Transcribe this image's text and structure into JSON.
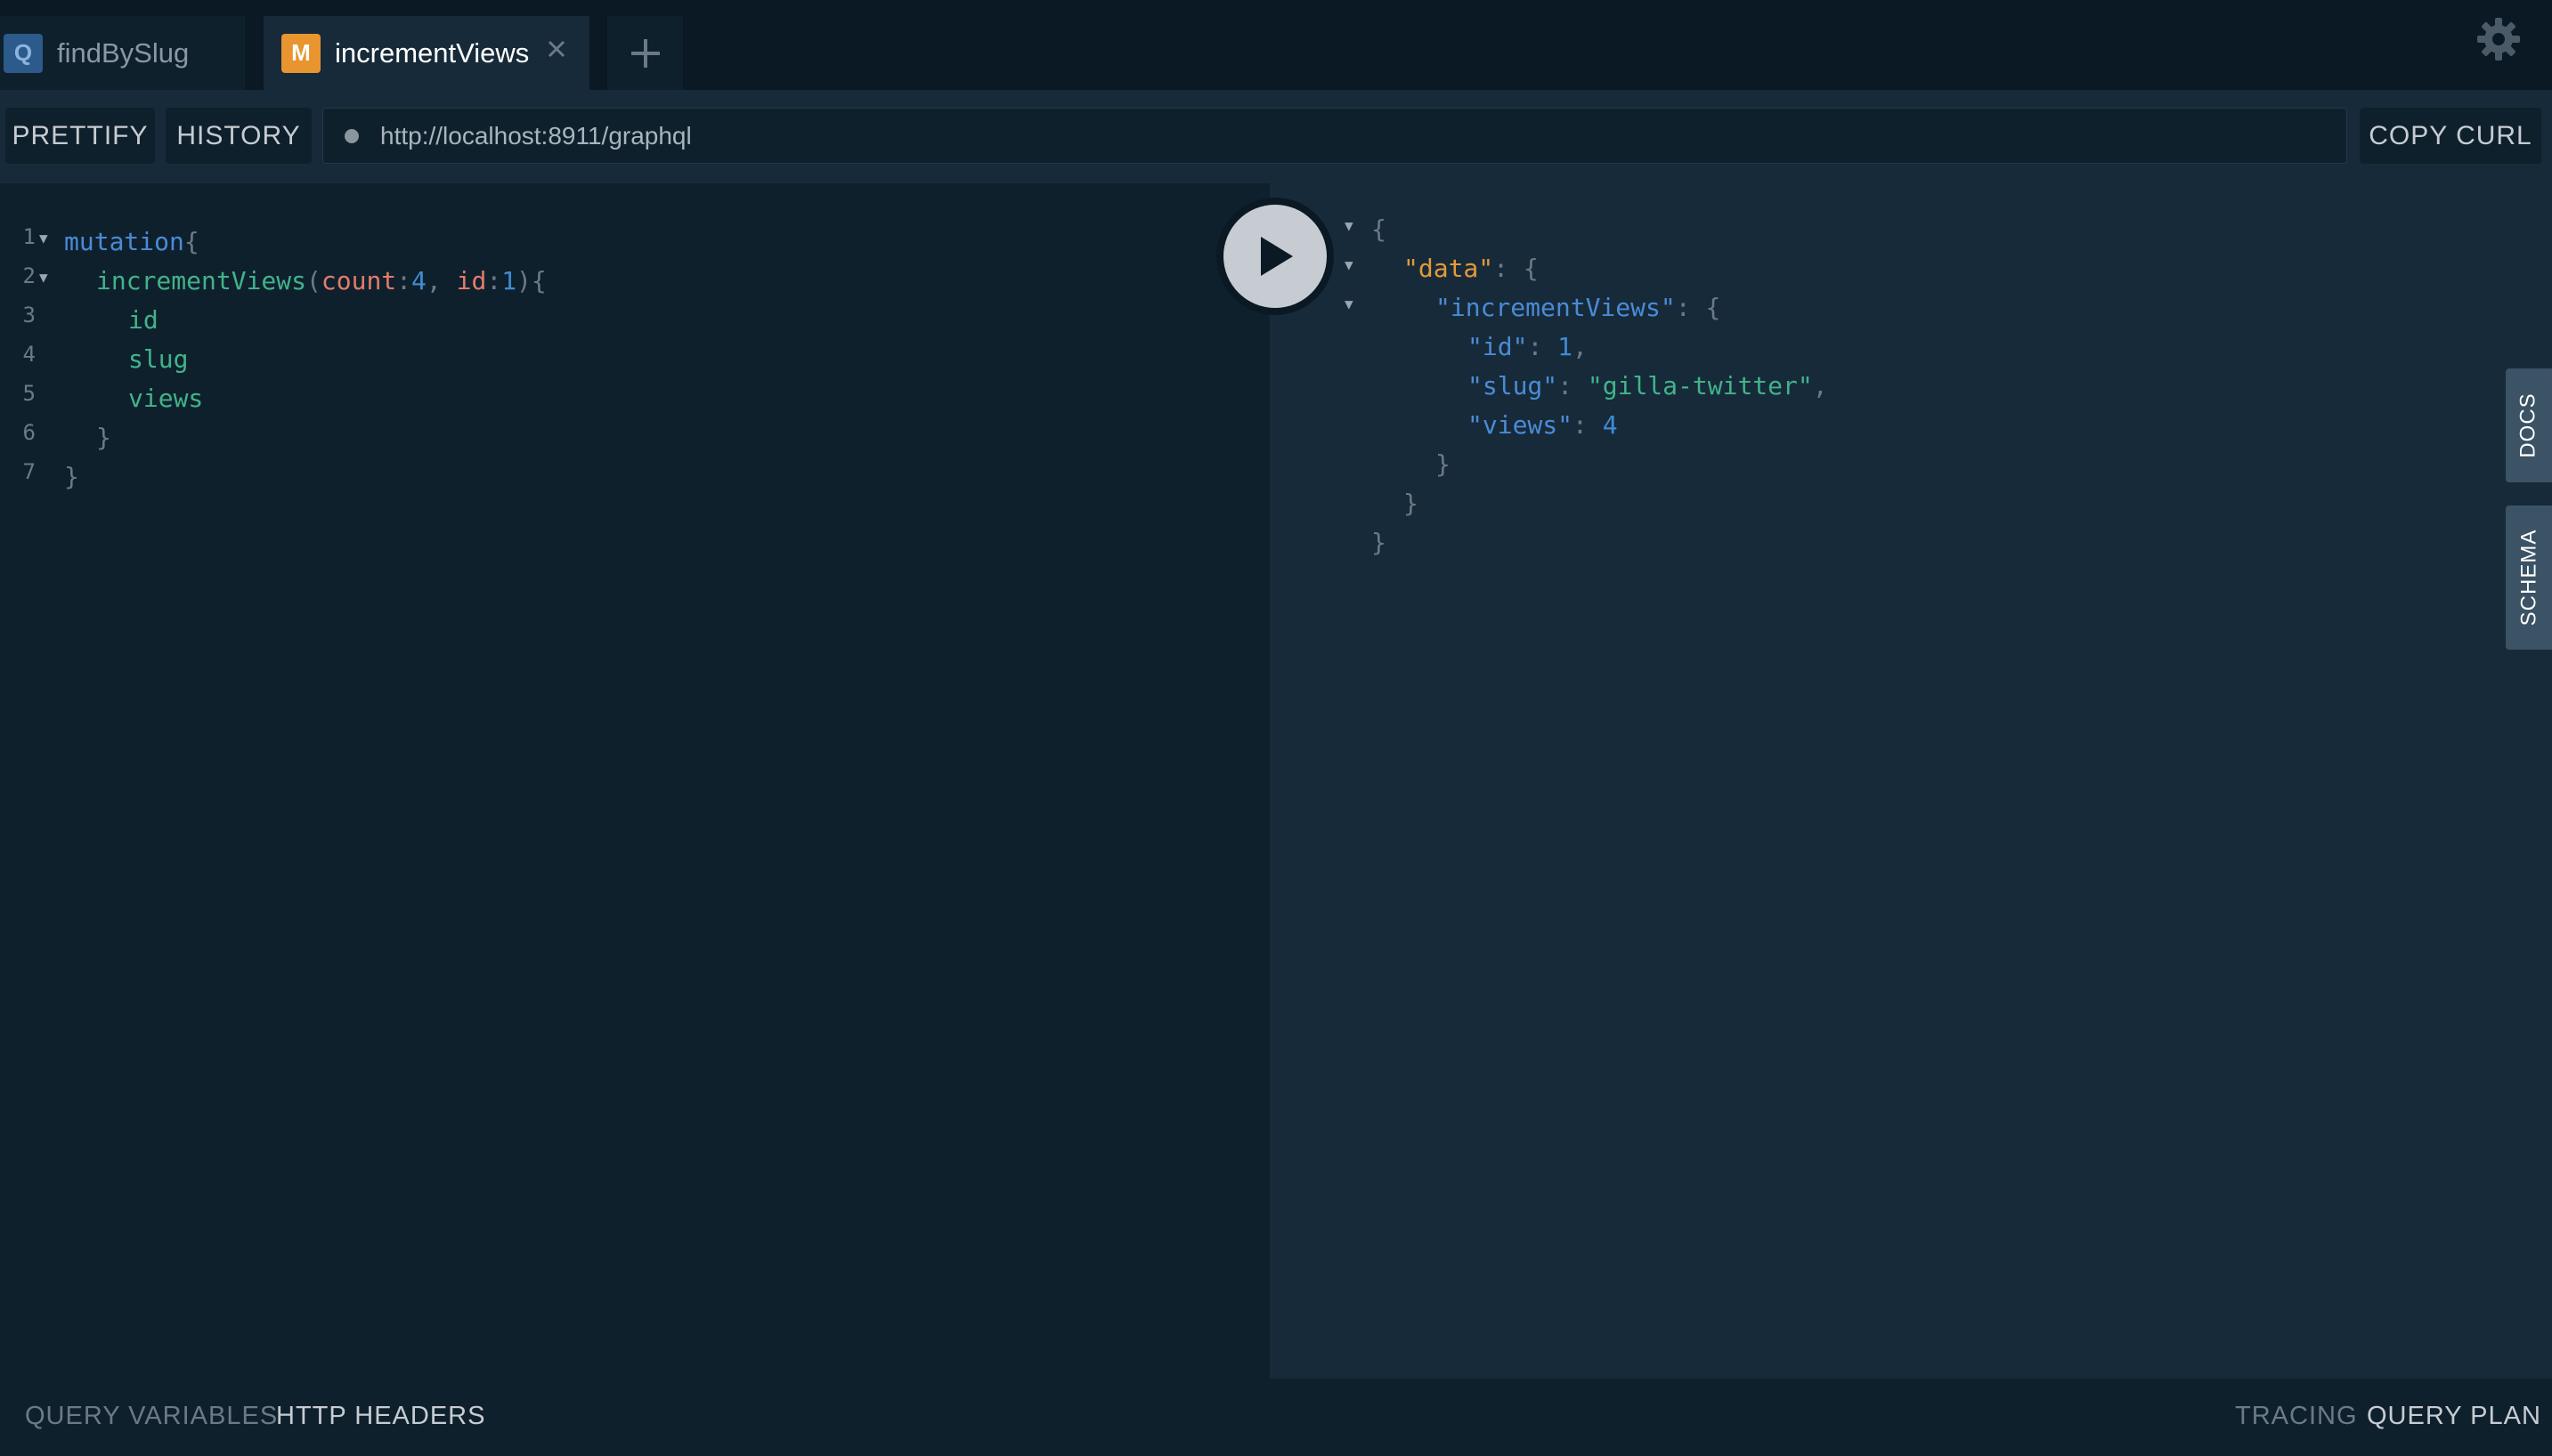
{
  "tabs": [
    {
      "badge": "Q",
      "label": "findBySlug",
      "active": false
    },
    {
      "badge": "M",
      "label": "incrementViews",
      "active": true
    }
  ],
  "toolbar": {
    "prettify": "PRETTIFY",
    "history": "HISTORY",
    "endpoint": "http://localhost:8911/graphql",
    "copy_curl": "COPY CURL"
  },
  "editor": {
    "line_numbers": [
      "1",
      "2",
      "3",
      "4",
      "5",
      "6",
      "7"
    ],
    "tokens": {
      "mutation": "mutation",
      "brace_open": "{",
      "field": "incrementViews",
      "paren_open": "(",
      "arg1_name": "count",
      "arg1_colon": ":",
      "arg1_value": "4",
      "comma": ", ",
      "arg2_name": "id",
      "arg2_colon": ":",
      "arg2_value": "1",
      "paren_close": ")",
      "sel1": "id",
      "sel2": "slug",
      "sel3": "views",
      "brace_close": "}"
    }
  },
  "result": {
    "open": "{",
    "data_key": "\"data\"",
    "colon": ": ",
    "inner_open": "{",
    "mutation_key": "\"incrementViews\"",
    "id_key": "\"id\"",
    "id_value": "1",
    "slug_key": "\"slug\"",
    "slug_value": "\"gilla-twitter\"",
    "views_key": "\"views\"",
    "views_value": "4",
    "comma": ",",
    "close": "}"
  },
  "side_tabs": {
    "docs": "DOCS",
    "schema": "SCHEMA"
  },
  "bottom": {
    "query_variables": "QUERY VARIABLES",
    "http_headers": "HTTP HEADERS",
    "tracing": "TRACING",
    "query_plan": "QUERY PLAN"
  },
  "colors": {
    "background": "#172a3a",
    "editor_background": "#0f202d",
    "tabbar_background": "#0b1924",
    "mutation_badge": "#e8942f",
    "query_badge": "#2c5a8a"
  }
}
